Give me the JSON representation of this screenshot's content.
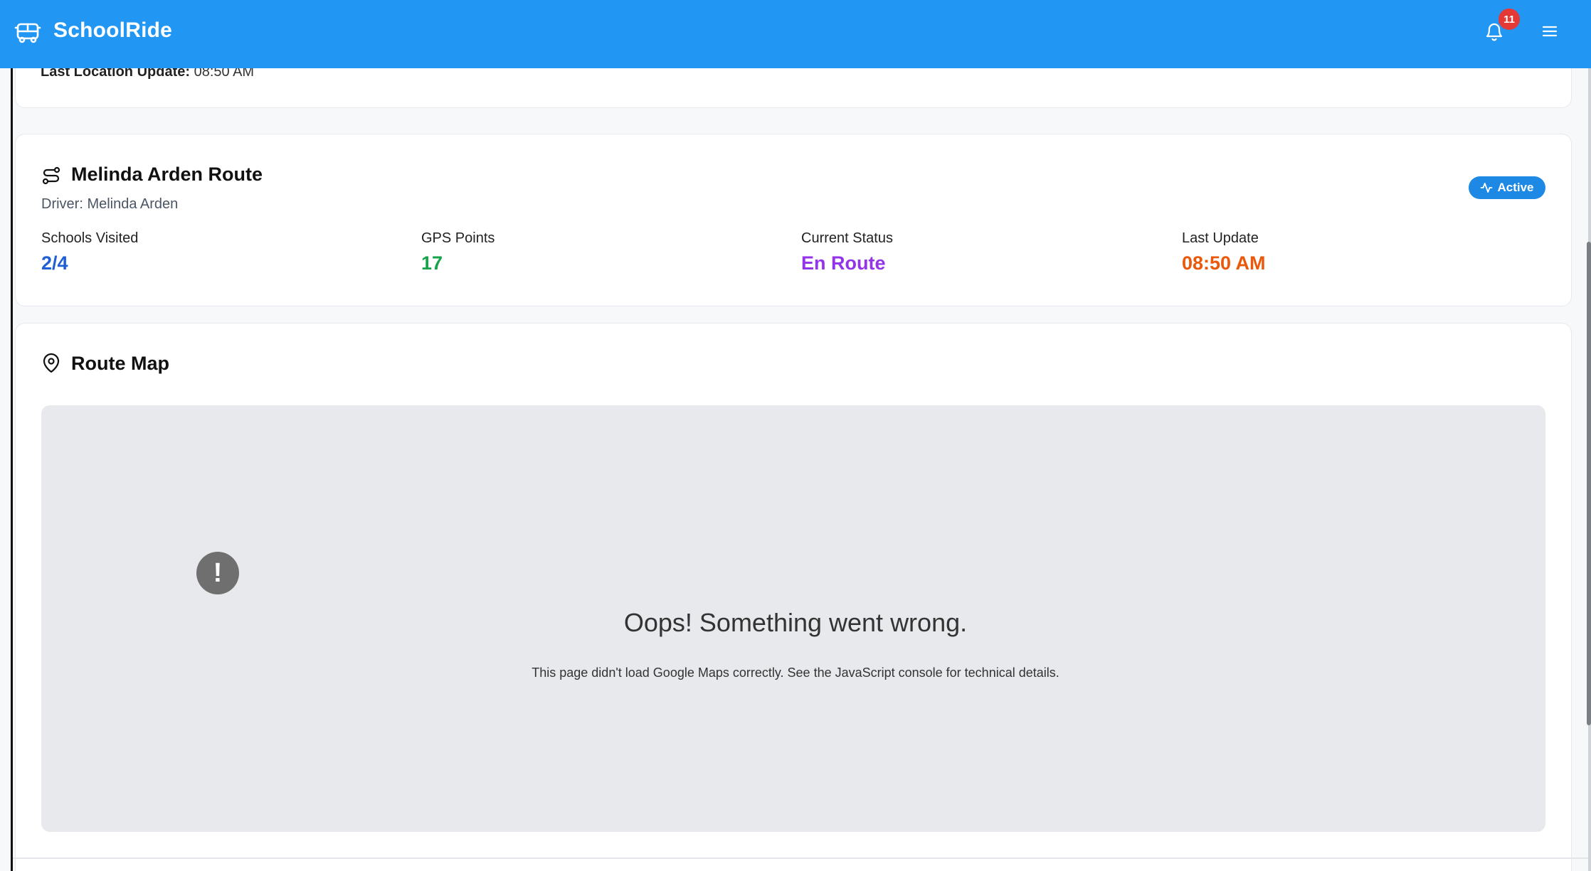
{
  "app": {
    "brand": "SchoolRide",
    "notifications_count": "11"
  },
  "top_card": {
    "last_location_label": "Last Location Update:",
    "last_location_value": "08:50 AM"
  },
  "route": {
    "title": "Melinda Arden Route",
    "driver": "Driver: Melinda Arden",
    "status_badge": "Active",
    "stats": [
      {
        "label": "Schools Visited",
        "value": "2/4",
        "color": "#1e5fd6"
      },
      {
        "label": "GPS Points",
        "value": "17",
        "color": "#16a34a"
      },
      {
        "label": "Current Status",
        "value": "En Route",
        "color": "#9333ea"
      },
      {
        "label": "Last Update",
        "value": "08:50 AM",
        "color": "#ea580c"
      }
    ]
  },
  "map": {
    "title": "Route Map",
    "error_title": "Oops! Something went wrong.",
    "error_text": "This page didn't load Google Maps correctly. See the JavaScript console for technical details."
  },
  "colors": {
    "appbar": "#2196f3",
    "badge": "#e53935",
    "active": "#1e88e5"
  },
  "icons": [
    "bus-icon",
    "bell-icon",
    "menu-icon",
    "route-icon",
    "activity-icon",
    "map-pin-icon",
    "error-icon"
  ]
}
